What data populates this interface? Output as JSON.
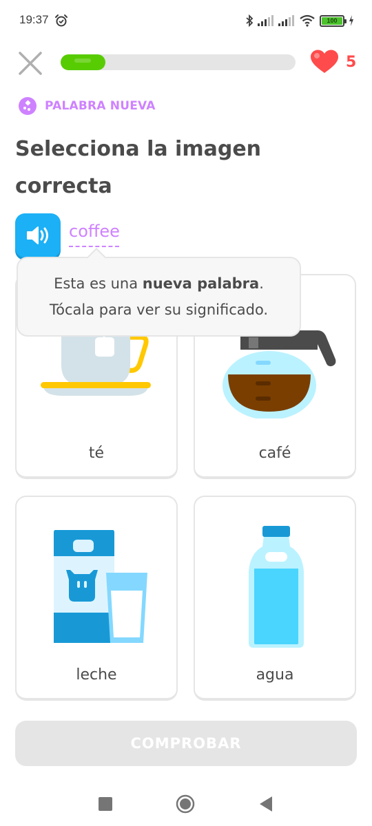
{
  "status_bar": {
    "time": "19:37",
    "alarm_icon": "alarm-clock-icon",
    "icons": [
      "bluetooth-icon",
      "signal-icon",
      "signal-icon",
      "wifi-icon"
    ],
    "battery_level": "100",
    "charging_icon": "charging-bolt-icon"
  },
  "header": {
    "close_icon": "close-x-icon",
    "progress_fraction": 0.19,
    "hearts_icon": "heart-icon",
    "hearts_count": "5"
  },
  "badge": {
    "icon": "new-word-icon",
    "label": "PALABRA NUEVA"
  },
  "prompt": {
    "title": "Selecciona la imagen correcta",
    "speaker_icon": "speaker-icon",
    "word": "coffee"
  },
  "tooltip": {
    "line1_prefix": "Esta es una ",
    "line1_bold": "nueva palabra",
    "line1_suffix": ".",
    "line2": "Tócala para ver su significado."
  },
  "choices": [
    {
      "label": "té",
      "image": "tea-cup-image"
    },
    {
      "label": "café",
      "image": "coffee-pot-image"
    },
    {
      "label": "leche",
      "image": "milk-carton-image"
    },
    {
      "label": "agua",
      "image": "water-bottle-image"
    }
  ],
  "check_button": {
    "label": "COMPROBAR",
    "enabled": false
  },
  "nav_bar": {
    "recents_icon": "recents-square-icon",
    "home_icon": "home-circle-icon",
    "back_icon": "back-triangle-icon"
  },
  "colors": {
    "progress_green": "#58cc02",
    "heart_red": "#ff4b4b",
    "accent_purple": "#ce82ff",
    "speaker_blue": "#1cb0f6",
    "disabled_gray": "#e5e5e5"
  }
}
